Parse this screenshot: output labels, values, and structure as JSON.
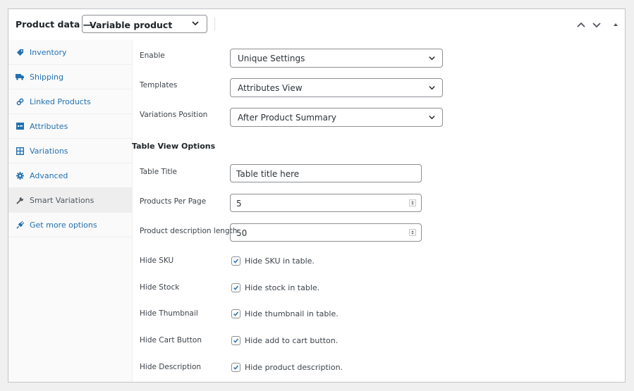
{
  "header": {
    "title": "Product data —",
    "product_type": "Variable product"
  },
  "sidebar": {
    "items": [
      {
        "label": "Inventory",
        "icon": "tag-icon"
      },
      {
        "label": "Shipping",
        "icon": "truck-icon"
      },
      {
        "label": "Linked Products",
        "icon": "link-icon"
      },
      {
        "label": "Attributes",
        "icon": "list-icon"
      },
      {
        "label": "Variations",
        "icon": "grid-icon"
      },
      {
        "label": "Advanced",
        "icon": "gear-icon"
      },
      {
        "label": "Smart Variations",
        "icon": "wrench-icon",
        "active": true
      },
      {
        "label": "Get more options",
        "icon": "plugin-icon"
      }
    ]
  },
  "form": {
    "enable": {
      "label": "Enable",
      "value": "Unique Settings"
    },
    "templates": {
      "label": "Templates",
      "value": "Attributes View"
    },
    "position": {
      "label": "Variations Position",
      "value": "After Product Summary"
    },
    "section_title": "Table View Options",
    "table_title": {
      "label": "Table Title",
      "value": "Table title here"
    },
    "per_page": {
      "label": "Products Per Page",
      "value": "5"
    },
    "desc_length": {
      "label": "Product description length",
      "value": "50"
    },
    "checkboxes": [
      {
        "label": "Hide SKU",
        "text": "Hide SKU in table.",
        "checked": true
      },
      {
        "label": "Hide Stock",
        "text": "Hide stock in table.",
        "checked": true
      },
      {
        "label": "Hide Thumbnail",
        "text": "Hide thumbnail in table.",
        "checked": true
      },
      {
        "label": "Hide Cart Button",
        "text": "Hide add to cart button.",
        "checked": true
      },
      {
        "label": "Hide Description",
        "text": "Hide product description.",
        "checked": true
      }
    ]
  },
  "colors": {
    "accent": "#2271b1",
    "check": "#2271b1"
  }
}
